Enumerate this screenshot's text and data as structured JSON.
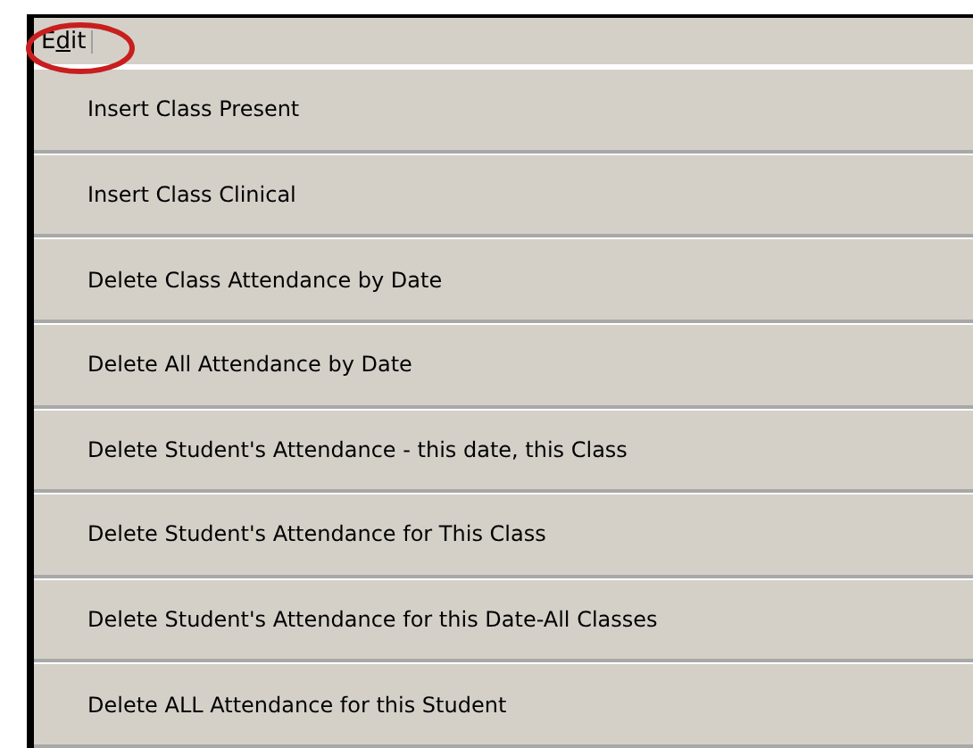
{
  "menu": {
    "title": [
      {
        "text": "E",
        "underlined": false
      },
      {
        "text": "d",
        "underlined": true
      },
      {
        "text": "it",
        "underlined": false
      }
    ],
    "highlighted": true,
    "items": [
      {
        "label": "Insert Class Present"
      },
      {
        "label": "Insert Class Clinical"
      },
      {
        "label": "Delete Class Attendance by Date"
      },
      {
        "label": "Delete All Attendance by Date"
      },
      {
        "label": "Delete Student's Attendance - this date, this Class"
      },
      {
        "label": "Delete Student's Attendance for This Class"
      },
      {
        "label": "Delete Student's Attendance for this Date-All Classes"
      },
      {
        "label": "Delete ALL Attendance for this Student"
      }
    ]
  }
}
